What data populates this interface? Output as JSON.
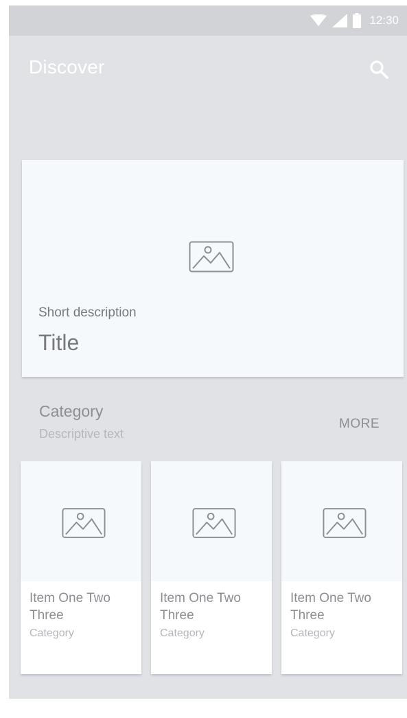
{
  "status_bar": {
    "time": "12:30",
    "icons": [
      "wifi-icon",
      "cell-signal-icon",
      "battery-icon"
    ]
  },
  "app_bar": {
    "title": "Discover",
    "search_icon": "search-icon"
  },
  "featured": {
    "description": "Short description",
    "title": "Title",
    "image_icon": "image-placeholder-icon"
  },
  "category": {
    "title": "Category",
    "subtitle": "Descriptive text",
    "more_label": "MORE"
  },
  "items": [
    {
      "name": "Item One Two Three",
      "category": "Category"
    },
    {
      "name": "Item One Two Three",
      "category": "Category"
    },
    {
      "name": "Item One Two Three",
      "category": "Category"
    }
  ],
  "colors": {
    "background": "#e1e2e6",
    "status_bar": "#d2d3d7",
    "card": "#f5f9fc",
    "text_primary": "#77797e",
    "text_secondary": "#b5b7bc"
  }
}
